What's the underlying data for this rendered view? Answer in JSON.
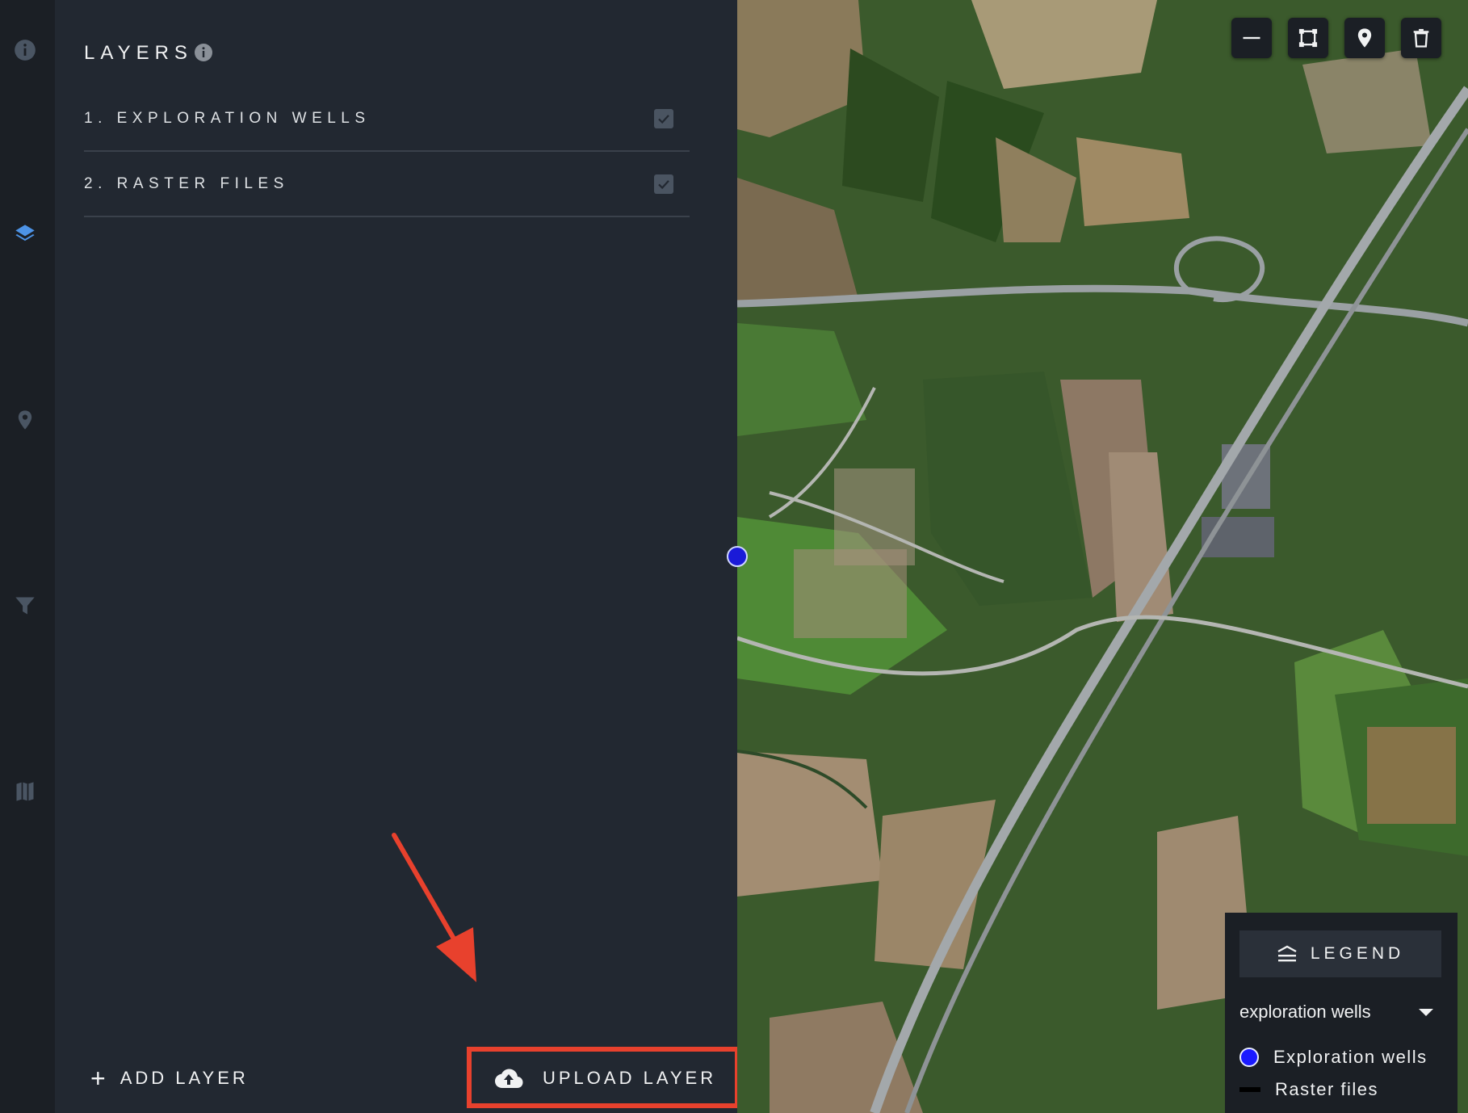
{
  "rail": {
    "items": [
      {
        "icon": "info-icon",
        "active": false
      },
      {
        "icon": "layers-icon",
        "active": true
      },
      {
        "icon": "location-pin-icon",
        "active": false
      },
      {
        "icon": "filter-icon",
        "active": false
      },
      {
        "icon": "map-icon",
        "active": false
      }
    ],
    "active_color": "#4d93e6",
    "inactive_color": "#4a5563"
  },
  "panel": {
    "title": "LAYERS",
    "layers": [
      {
        "label": "1. EXPLORATION WELLS",
        "checked": true
      },
      {
        "label": "2. RASTER FILES",
        "checked": true
      }
    ],
    "add_layer_label": "ADD LAYER",
    "upload_layer_label": "UPLOAD LAYER",
    "highlight_color": "#e8412d"
  },
  "map": {
    "tools": [
      "line-tool-icon",
      "polygon-tool-icon",
      "marker-tool-icon",
      "trash-icon"
    ],
    "marker_color": "#1a1ad8"
  },
  "legend": {
    "button_label": "LEGEND",
    "selected_layer": "exploration wells",
    "items": [
      {
        "label": "Exploration wells",
        "symbol": "circle",
        "color": "#1a1aff"
      },
      {
        "label": "Raster files",
        "symbol": "line",
        "color": "#000000"
      }
    ]
  }
}
